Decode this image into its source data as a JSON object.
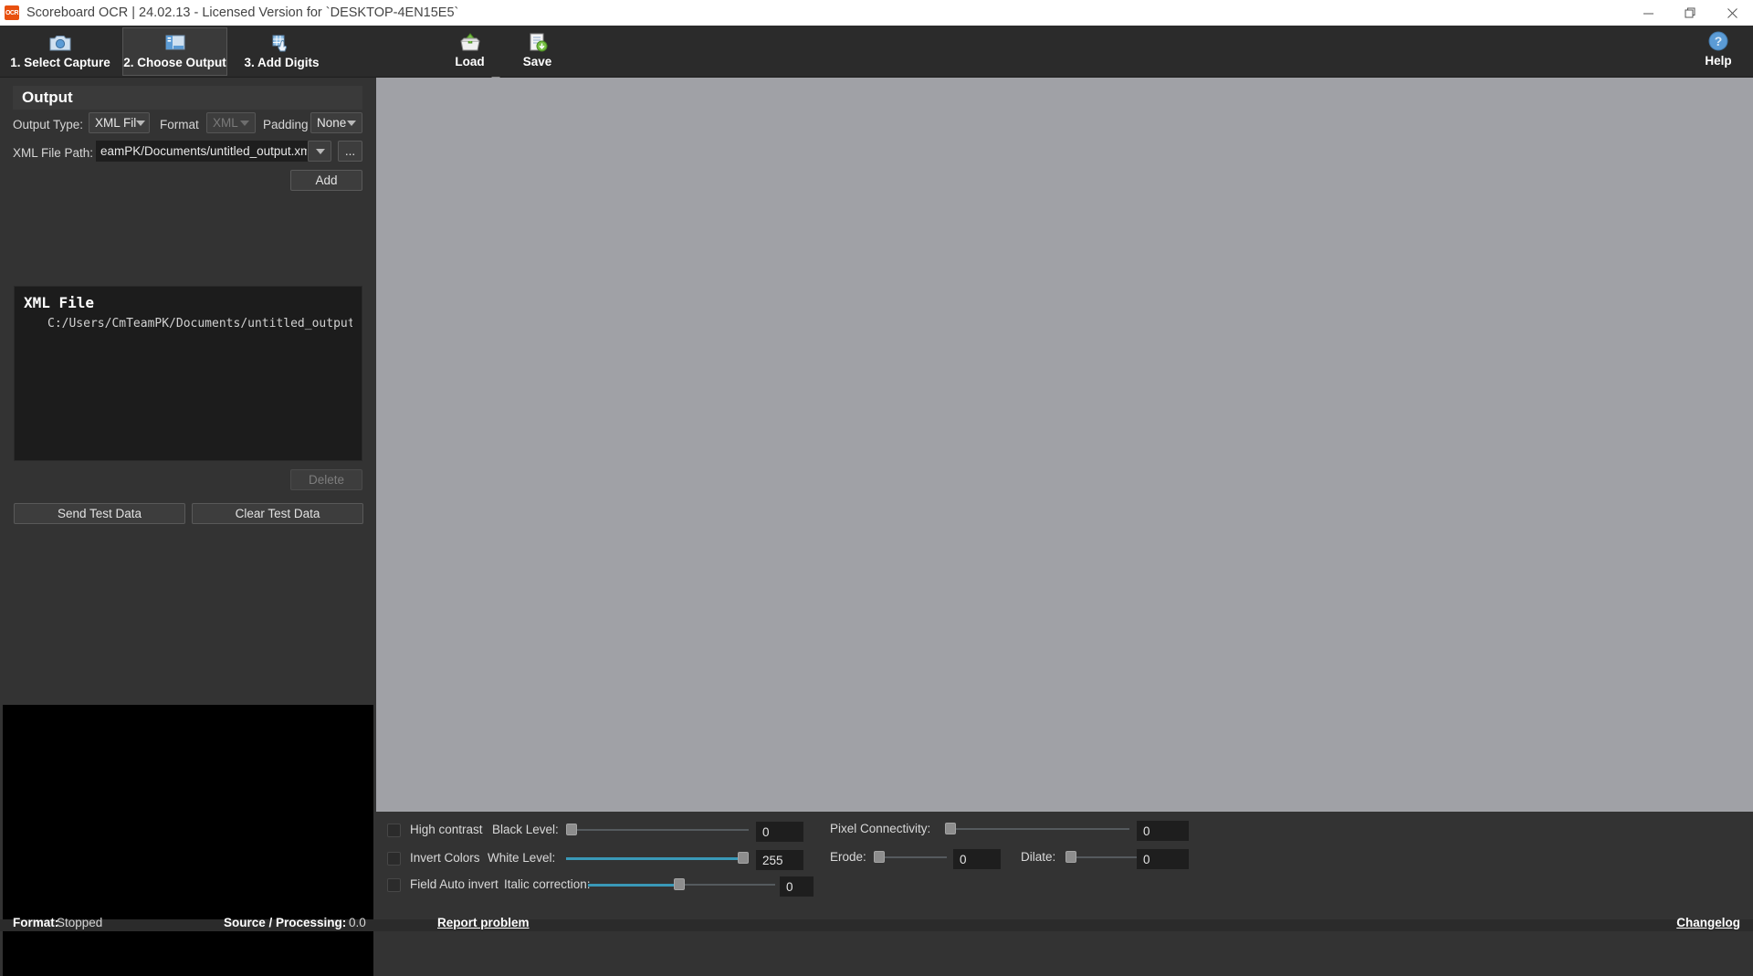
{
  "window": {
    "title": "Scoreboard OCR | 24.02.13 - Licensed Version for `DESKTOP-4EN15E5`",
    "logo_text": "OCR",
    "minimize": "—",
    "maximize": "❐",
    "close": "✕"
  },
  "ribbon": {
    "tabs": [
      {
        "label": "1. Select Capture",
        "icon": "camera-icon",
        "active": false
      },
      {
        "label": "2. Choose Output",
        "icon": "window-icon",
        "active": true
      },
      {
        "label": "3. Add Digits",
        "icon": "hand-click-icon",
        "active": false
      }
    ],
    "buttons": [
      {
        "label": "Load",
        "icon": "open-box-icon"
      },
      {
        "label": "Save",
        "icon": "save-disk-icon"
      }
    ],
    "help": {
      "label": "Help",
      "icon": "question-circle-icon"
    }
  },
  "output_panel": {
    "header": "Output",
    "output_type": {
      "label": "Output Type:",
      "value": "XML Fil"
    },
    "format": {
      "label": "Format",
      "value": "XML",
      "disabled": true
    },
    "padding": {
      "label": "Padding",
      "value": "None"
    },
    "file_path": {
      "label": "XML File Path:",
      "value": "eamPK/Documents/untitled_output.xml"
    },
    "browse_label": "...",
    "add_label": "Add",
    "list": {
      "title": "XML File",
      "entry": "C:/Users/CmTeamPK/Documents/untitled_output"
    },
    "delete_label": "Delete",
    "send_test_label": "Send Test Data",
    "clear_test_label": "Clear Test Data"
  },
  "image_controls": {
    "high_contrast": "High contrast",
    "invert_colors": "Invert Colors",
    "field_auto_invert": "Field Auto invert",
    "black_level": {
      "label": "Black Level:",
      "value": "0",
      "percent": 0
    },
    "white_level": {
      "label": "White Level:",
      "value": "255",
      "percent": 100
    },
    "italic_correction": {
      "label": "Italic correction:",
      "value": "0",
      "percent": 50
    },
    "pixel_connectivity": {
      "label": "Pixel Connectivity:",
      "value": "0",
      "percent": 0
    },
    "erode": {
      "label": "Erode:",
      "value": "0",
      "percent": 0
    },
    "dilate": {
      "label": "Dilate:",
      "value": "0",
      "percent": 0
    }
  },
  "status": {
    "format_key": "Format:",
    "format_value": "Stopped",
    "source_key": "Source / Processing:",
    "source_value": "0.0",
    "report_problem": "Report problem",
    "changelog": "Changelog"
  },
  "colors": {
    "accent": "#3a99b8",
    "panel": "#333333",
    "preview": "#a0a1a6",
    "logo": "#e8500f"
  }
}
